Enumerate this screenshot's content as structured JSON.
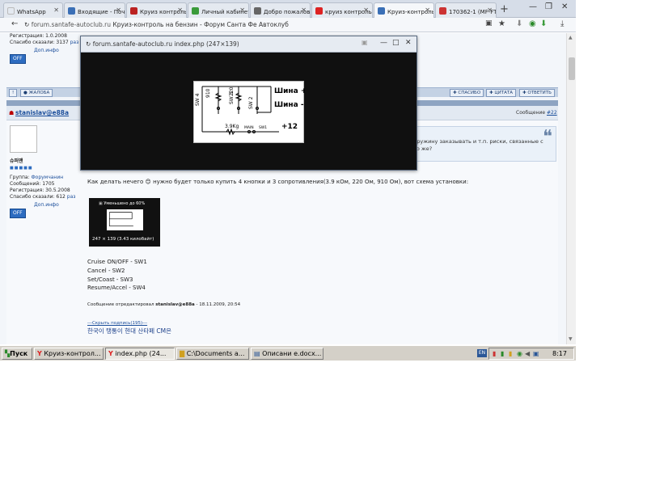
{
  "tabs": [
    {
      "label": "WhatsApp",
      "color": "#e4e9f0"
    },
    {
      "label": "Входящие - Почт",
      "color": "#3a6fb6"
    },
    {
      "label": "Круиз контроль и",
      "color": "#b22"
    },
    {
      "label": "Личный кабинет",
      "color": "#3a9b3a"
    },
    {
      "label": "Добро пожалова",
      "color": "#666"
    },
    {
      "label": "круиз контроль н",
      "color": "#d22"
    },
    {
      "label": "Круиз-контроль",
      "color": "#3a6fb6"
    },
    {
      "label": "170362-1 (MF-FT",
      "color": "#c33"
    }
  ],
  "address": {
    "host": "forum.santafe-autoclub.ru",
    "title": "Круиз-контроль на бензин - Форум Санта Фе Автоклуб"
  },
  "top_user": {
    "reg": "Регистрация: 1.0.2008",
    "thanks": "Спасибо сказали: 3137",
    "thanks_link": "раз",
    "dop_info": "Доп.инфо",
    "off": "OFF"
  },
  "toolbar": {
    "warn": "!",
    "complaint": "ЖАЛОБА",
    "thanks": "СПАСИБО",
    "quote": "ЦИТАТА",
    "reply": "ОТВЕТИТЬ"
  },
  "post": {
    "author": "stanislav@e88a",
    "message_label": "Сообщение",
    "message_num": "#22",
    "avatar_caption": "슈퍼맨",
    "group_label": "Группа:",
    "group_value": "Форумчанин",
    "messages": "Сообщений: 1705",
    "registered": "Регистрация: 30.5.2008",
    "thanks": "Спасибо сказали: 612",
    "thanks_link": "раз",
    "dop_info": "Доп.инфо",
    "off": "OFF",
    "quote_line1": "пружину заказывать и т.п. риски, связанные с",
    "quote_line2": "во же?",
    "body_text": "Как делать нечего 😊 нужно будет только купить 4 кнопки и 3 сопротивления(3.9 кОм, 220 Ом, 910 Ом), вот схема установки:",
    "thumb_caption": "Уменьшено до 60%",
    "thumb_size": "247 × 139 (3.43 килобайт)",
    "lines": [
      "Cruise ON/OFF - SW1",
      "Cancel - SW2",
      "Set/Coast - SW3",
      "Resume/Accel - SW4"
    ],
    "edited_prefix": "Сообщение отредактировал",
    "edited_by": "stanislav@e88a",
    "edited_date": " - 18.11.2009, 20:54",
    "sig_toggle": "---Скрыть подпись(195)---",
    "sig_text": "한국이 탱통이 현대 산타페 CM은"
  },
  "popup": {
    "title": "forum.santafe-autoclub.ru index.php (247×139)",
    "schema": {
      "bus_plus": "Шина +",
      "bus_minus": "Шина -",
      "r1": "3.9Kg",
      "main": "MAIN",
      "sw1": "SW1",
      "plus12": "+12",
      "sw4": "SW 4",
      "sw3": "SW 3",
      "sw2": "SW 2",
      "r910": "910",
      "r220": "220"
    }
  },
  "taskbar": {
    "start": "Пуск",
    "tasks": [
      "Круиз-контрол...",
      "index.php (24...",
      "C:\\Documents a...",
      "Описани e.docx..."
    ],
    "lang": "EN",
    "time": "8:17"
  }
}
